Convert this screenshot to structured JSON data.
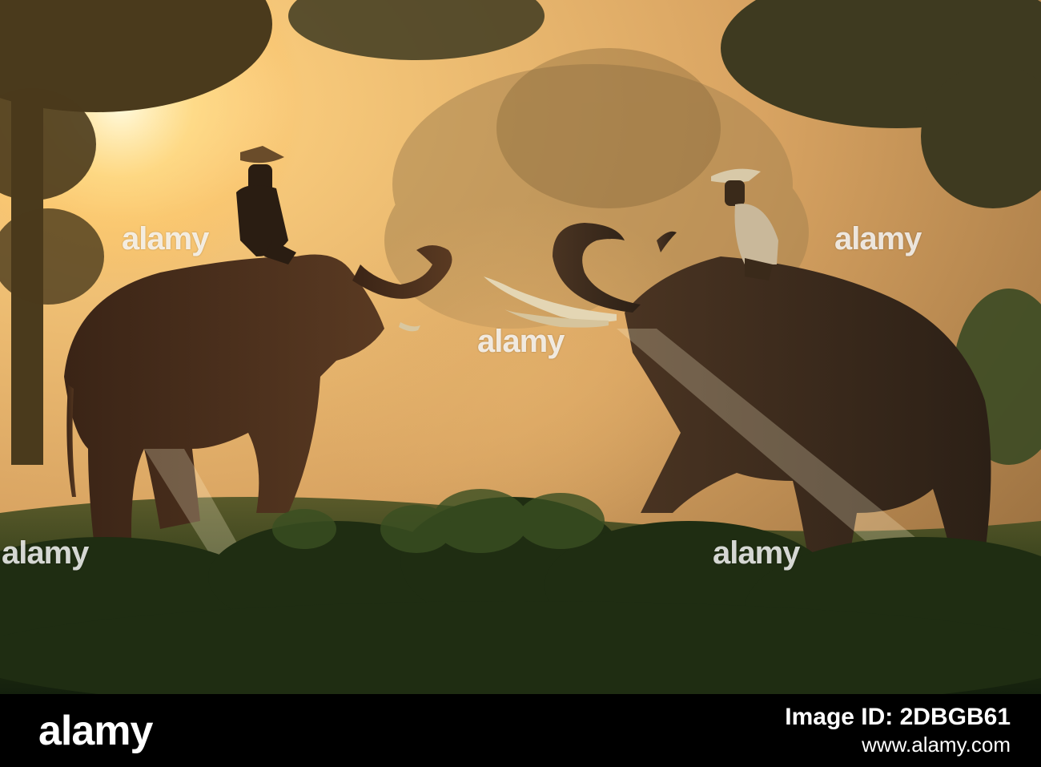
{
  "photo": {
    "subject": "two-elephants-with-riders-at-sunrise"
  },
  "watermarks": {
    "top_left": "alamy",
    "top_right": "alamy",
    "center": "alamy",
    "bottom_left": "alamy",
    "bottom_right": "alamy"
  },
  "footer": {
    "brand": "alamy",
    "image_id_label": "Image ID: 2DBGB61",
    "url": "www.alamy.com"
  },
  "colors": {
    "sky": "#e9b870",
    "sun": "#fff3c0",
    "foliage": "#2f3a20",
    "silhouette": "#2a1d13",
    "footer": "#000000"
  }
}
